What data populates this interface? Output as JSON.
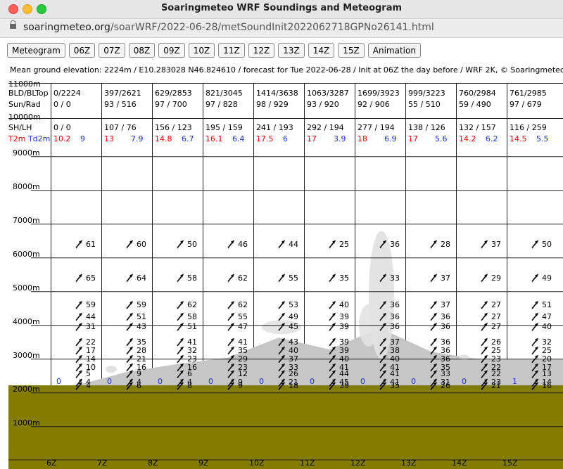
{
  "window": {
    "title": "Soaringmeteo WRF Soundings and Meteogram"
  },
  "url": {
    "scheme": "soaringmeteo.org",
    "path": "/soarWRF/2022-06-28/metSoundInit2022062718GPNo26141.html"
  },
  "buttons": [
    "Meteogram",
    "06Z",
    "07Z",
    "08Z",
    "09Z",
    "10Z",
    "11Z",
    "12Z",
    "13Z",
    "14Z",
    "15Z",
    "Animation"
  ],
  "info": "Mean ground elevation: 2224m / E10.283028 N46.824610 / forecast for Tue 2022-06-28 / Init at 06Z the day before / WRF 2K, © Soaringmeteo.",
  "row_labels": {
    "bld": "BLD/BLTop",
    "sun": "Sun/Rad",
    "alt11": "11000m",
    "alt10": "10000m",
    "shlh": "SH/LH",
    "t2m": "T2m",
    "td2m": "Td2m"
  },
  "columns": [
    {
      "bld": "0/2224",
      "sun": "0 / 0",
      "shlh": "0 / 0",
      "t2m": "10.2",
      "td2m": "9"
    },
    {
      "bld": "397/2621",
      "sun": "93 / 516",
      "shlh": "107 / 76",
      "t2m": "13",
      "td2m": "7.9"
    },
    {
      "bld": "629/2853",
      "sun": "97 / 700",
      "shlh": "156 / 123",
      "t2m": "14.8",
      "td2m": "6.7"
    },
    {
      "bld": "821/3045",
      "sun": "97 / 828",
      "shlh": "195 / 159",
      "t2m": "16.1",
      "td2m": "6.4"
    },
    {
      "bld": "1414/3638",
      "sun": "98 / 929",
      "shlh": "241 / 193",
      "t2m": "17.5",
      "td2m": "6"
    },
    {
      "bld": "1063/3287",
      "sun": "93 / 920",
      "shlh": "292 / 194",
      "t2m": "17",
      "td2m": "3.9"
    },
    {
      "bld": "1699/3923",
      "sun": "92 / 906",
      "shlh": "277 / 194",
      "t2m": "18",
      "td2m": "6.9"
    },
    {
      "bld": "999/3223",
      "sun": "55 / 510",
      "shlh": "138 / 126",
      "t2m": "17",
      "td2m": "5.6"
    },
    {
      "bld": "760/2984",
      "sun": "59 / 490",
      "shlh": "132 / 157",
      "t2m": "14.2",
      "td2m": "6.2"
    },
    {
      "bld": "761/2985",
      "sun": "97 / 679",
      "shlh": "116 / 259",
      "t2m": "14.5",
      "td2m": "5.5"
    }
  ],
  "y_axis": [
    "9000m",
    "8000m",
    "7000m",
    "6000m",
    "5000m",
    "4000m",
    "3000m",
    "2000m",
    "1000m"
  ],
  "x_axis": [
    "6Z",
    "7Z",
    "8Z",
    "9Z",
    "10Z",
    "11Z",
    "12Z",
    "13Z",
    "14Z",
    "15Z"
  ],
  "ground_elevation_m": 2224,
  "colors": {
    "ground": "#837c00",
    "boundary_layer": "#c6c6c6",
    "cloud": "#e2e2e2",
    "grid": "#222222",
    "temp": "#e00000",
    "dew": "#1a33d6"
  },
  "chart_data": {
    "type": "meteogram",
    "x": [
      "6Z",
      "7Z",
      "8Z",
      "9Z",
      "10Z",
      "11Z",
      "12Z",
      "13Z",
      "14Z",
      "15Z"
    ],
    "ylim": [
      0,
      9000
    ],
    "bl_top_m": [
      2224,
      2621,
      2853,
      3045,
      3638,
      3287,
      3923,
      3223,
      2984,
      2985
    ],
    "surface_wind_labels": [
      "0",
      "0",
      "0",
      "0",
      "0",
      "0",
      "0",
      "0",
      "0",
      "1"
    ],
    "cloud_cumulus_col6": {
      "base_m": 3000,
      "top_m": 6800
    },
    "winds": [
      {
        "alt_m": 2200,
        "speeds": [
          "4",
          "6",
          "8",
          "9",
          "18",
          "39",
          "35",
          "26",
          "21",
          "16"
        ]
      },
      {
        "alt_m": 2300,
        "speeds": [
          "4",
          "4",
          "4",
          "9",
          "21",
          "45",
          "41",
          "31",
          "23",
          "14"
        ]
      },
      {
        "alt_m": 2550,
        "speeds": [
          "5",
          "9",
          "6",
          "12",
          "26",
          "44",
          "41",
          "33",
          "22",
          "13"
        ]
      },
      {
        "alt_m": 2750,
        "speeds": [
          "10",
          "16",
          "16",
          "23",
          "33",
          "41",
          "41",
          "35",
          "22",
          "17"
        ]
      },
      {
        "alt_m": 3000,
        "speeds": [
          "14",
          "21",
          "23",
          "29",
          "37",
          "40",
          "40",
          "36",
          "23",
          "20"
        ]
      },
      {
        "alt_m": 3250,
        "speeds": [
          "17",
          "28",
          "32",
          "35",
          "40",
          "39",
          "38",
          "36",
          "25",
          "25"
        ]
      },
      {
        "alt_m": 3500,
        "speeds": [
          "22",
          "35",
          "41",
          "41",
          "43",
          "39",
          "37",
          "36",
          "26",
          "32"
        ]
      },
      {
        "alt_m": 3950,
        "speeds": [
          "31",
          "43",
          "51",
          "47",
          "45",
          "39",
          "36",
          "36",
          "27",
          "40"
        ]
      },
      {
        "alt_m": 4250,
        "speeds": [
          "44",
          "51",
          "58",
          "55",
          "49",
          "39",
          "36",
          "36",
          "27",
          "47"
        ]
      },
      {
        "alt_m": 4600,
        "speeds": [
          "59",
          "59",
          "62",
          "62",
          "53",
          "40",
          "36",
          "37",
          "27",
          "51"
        ]
      },
      {
        "alt_m": 5400,
        "speeds": [
          "65",
          "64",
          "58",
          "62",
          "55",
          "35",
          "33",
          "37",
          "29",
          "49"
        ]
      },
      {
        "alt_m": 6400,
        "speeds": [
          "61",
          "60",
          "50",
          "46",
          "44",
          "25",
          "36",
          "28",
          "37",
          "50"
        ]
      }
    ]
  }
}
